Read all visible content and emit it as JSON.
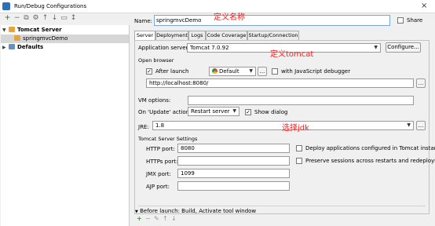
{
  "window": {
    "title": "Run/Debug Configurations",
    "close_glyph": "×"
  },
  "toolbar": {
    "buttons": [
      {
        "icon": "add-icon",
        "glyph": "+"
      },
      {
        "icon": "remove-icon",
        "glyph": "−"
      },
      {
        "icon": "copy-icon",
        "glyph": "⧉"
      },
      {
        "icon": "settings-icon",
        "glyph": "⚙"
      },
      {
        "icon": "move-up-icon",
        "glyph": "↑"
      },
      {
        "icon": "move-down-icon",
        "glyph": "↓"
      },
      {
        "icon": "folder-icon",
        "glyph": "▭"
      },
      {
        "icon": "sort-icon",
        "glyph": "↕"
      }
    ]
  },
  "tree": {
    "tomcat_group": "Tomcat Server",
    "tomcat_child": "springmvcDemo",
    "defaults": "Defaults"
  },
  "form": {
    "name_label": "Name:",
    "name_value": "springmvcDemo",
    "share_label": "Share",
    "tabs": [
      "Server",
      "Deployment",
      "Logs",
      "Code Coverage",
      "Startup/Connection"
    ],
    "app_server_label": "Application server:",
    "app_server_value": "Tomcat 7.0.92",
    "configure_button": "Configure...",
    "open_browser_label": "Open browser",
    "after_launch_label": "After launch",
    "browser_value": "Default",
    "ellipsis": "...",
    "js_debugger_label": "with JavaScript debugger",
    "url_value": "http://localhost:8080/",
    "vm_options_label": "VM options:",
    "on_update_label": "On 'Update' action:",
    "on_update_value": "Restart server",
    "show_dialog_label": "Show dialog",
    "jre_label": "JRE:",
    "jre_value": "1.8",
    "tomcat_settings_label": "Tomcat Server Settings",
    "http_port_label": "HTTP port:",
    "http_port_value": "8080",
    "https_port_label": "HTTPs port:",
    "https_port_value": "",
    "jmx_port_label": "JMX port:",
    "jmx_port_value": "1099",
    "ajp_port_label": "AJP port:",
    "ajp_port_value": "",
    "deploy_label": "Deploy applications configured in Tomcat instance",
    "preserve_label": "Preserve sessions across restarts and redeploys",
    "before_launch_label": "Before launch: Build, Activate tool window"
  },
  "annotations": {
    "name": "定义名称",
    "tomcat": "定义tomcat",
    "jdk": "选择jdk"
  },
  "colors": {
    "annotation": "#ff1a1a",
    "selection": "#d6d6d6",
    "focus_border": "#7aa7d9"
  }
}
